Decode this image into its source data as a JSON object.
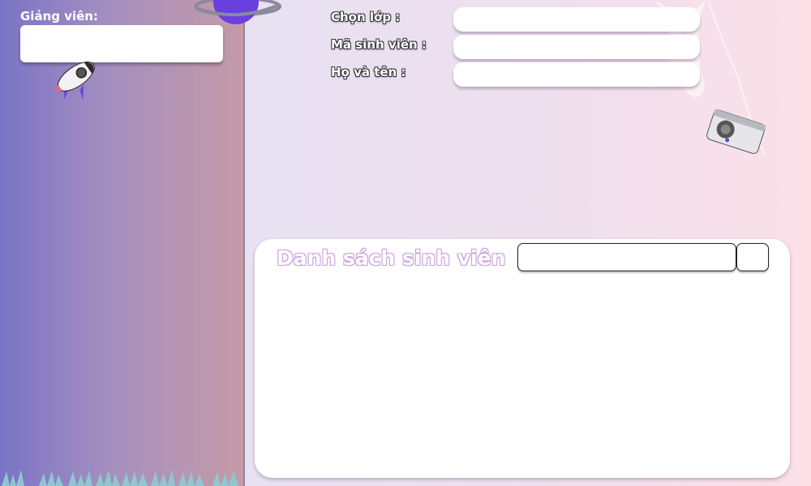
{
  "sidebar": {
    "lecturer_label": "Giảng viên:",
    "lecturer_value": ""
  },
  "form": {
    "class_label": "Chọn lớp :",
    "class_value": "",
    "student_id_label": "Mã sinh viên :",
    "student_id_value": "",
    "full_name_label": "Họ và tên :",
    "full_name_value": ""
  },
  "student_list": {
    "title": "Danh sách sinh viên",
    "search_value": "",
    "search_button_label": ""
  },
  "colors": {
    "sidebar_gradient_start": "#7a73c6",
    "sidebar_gradient_end": "#c59aa6",
    "main_gradient_start": "#e7e1f2",
    "main_gradient_end": "#fbe0e7",
    "title_outline": "#c8a1dd",
    "planet": "#6a3fe0"
  },
  "icons": [
    "rocket-icon",
    "planet-icon",
    "feather-icon",
    "camera-icon",
    "grass-decoration"
  ]
}
